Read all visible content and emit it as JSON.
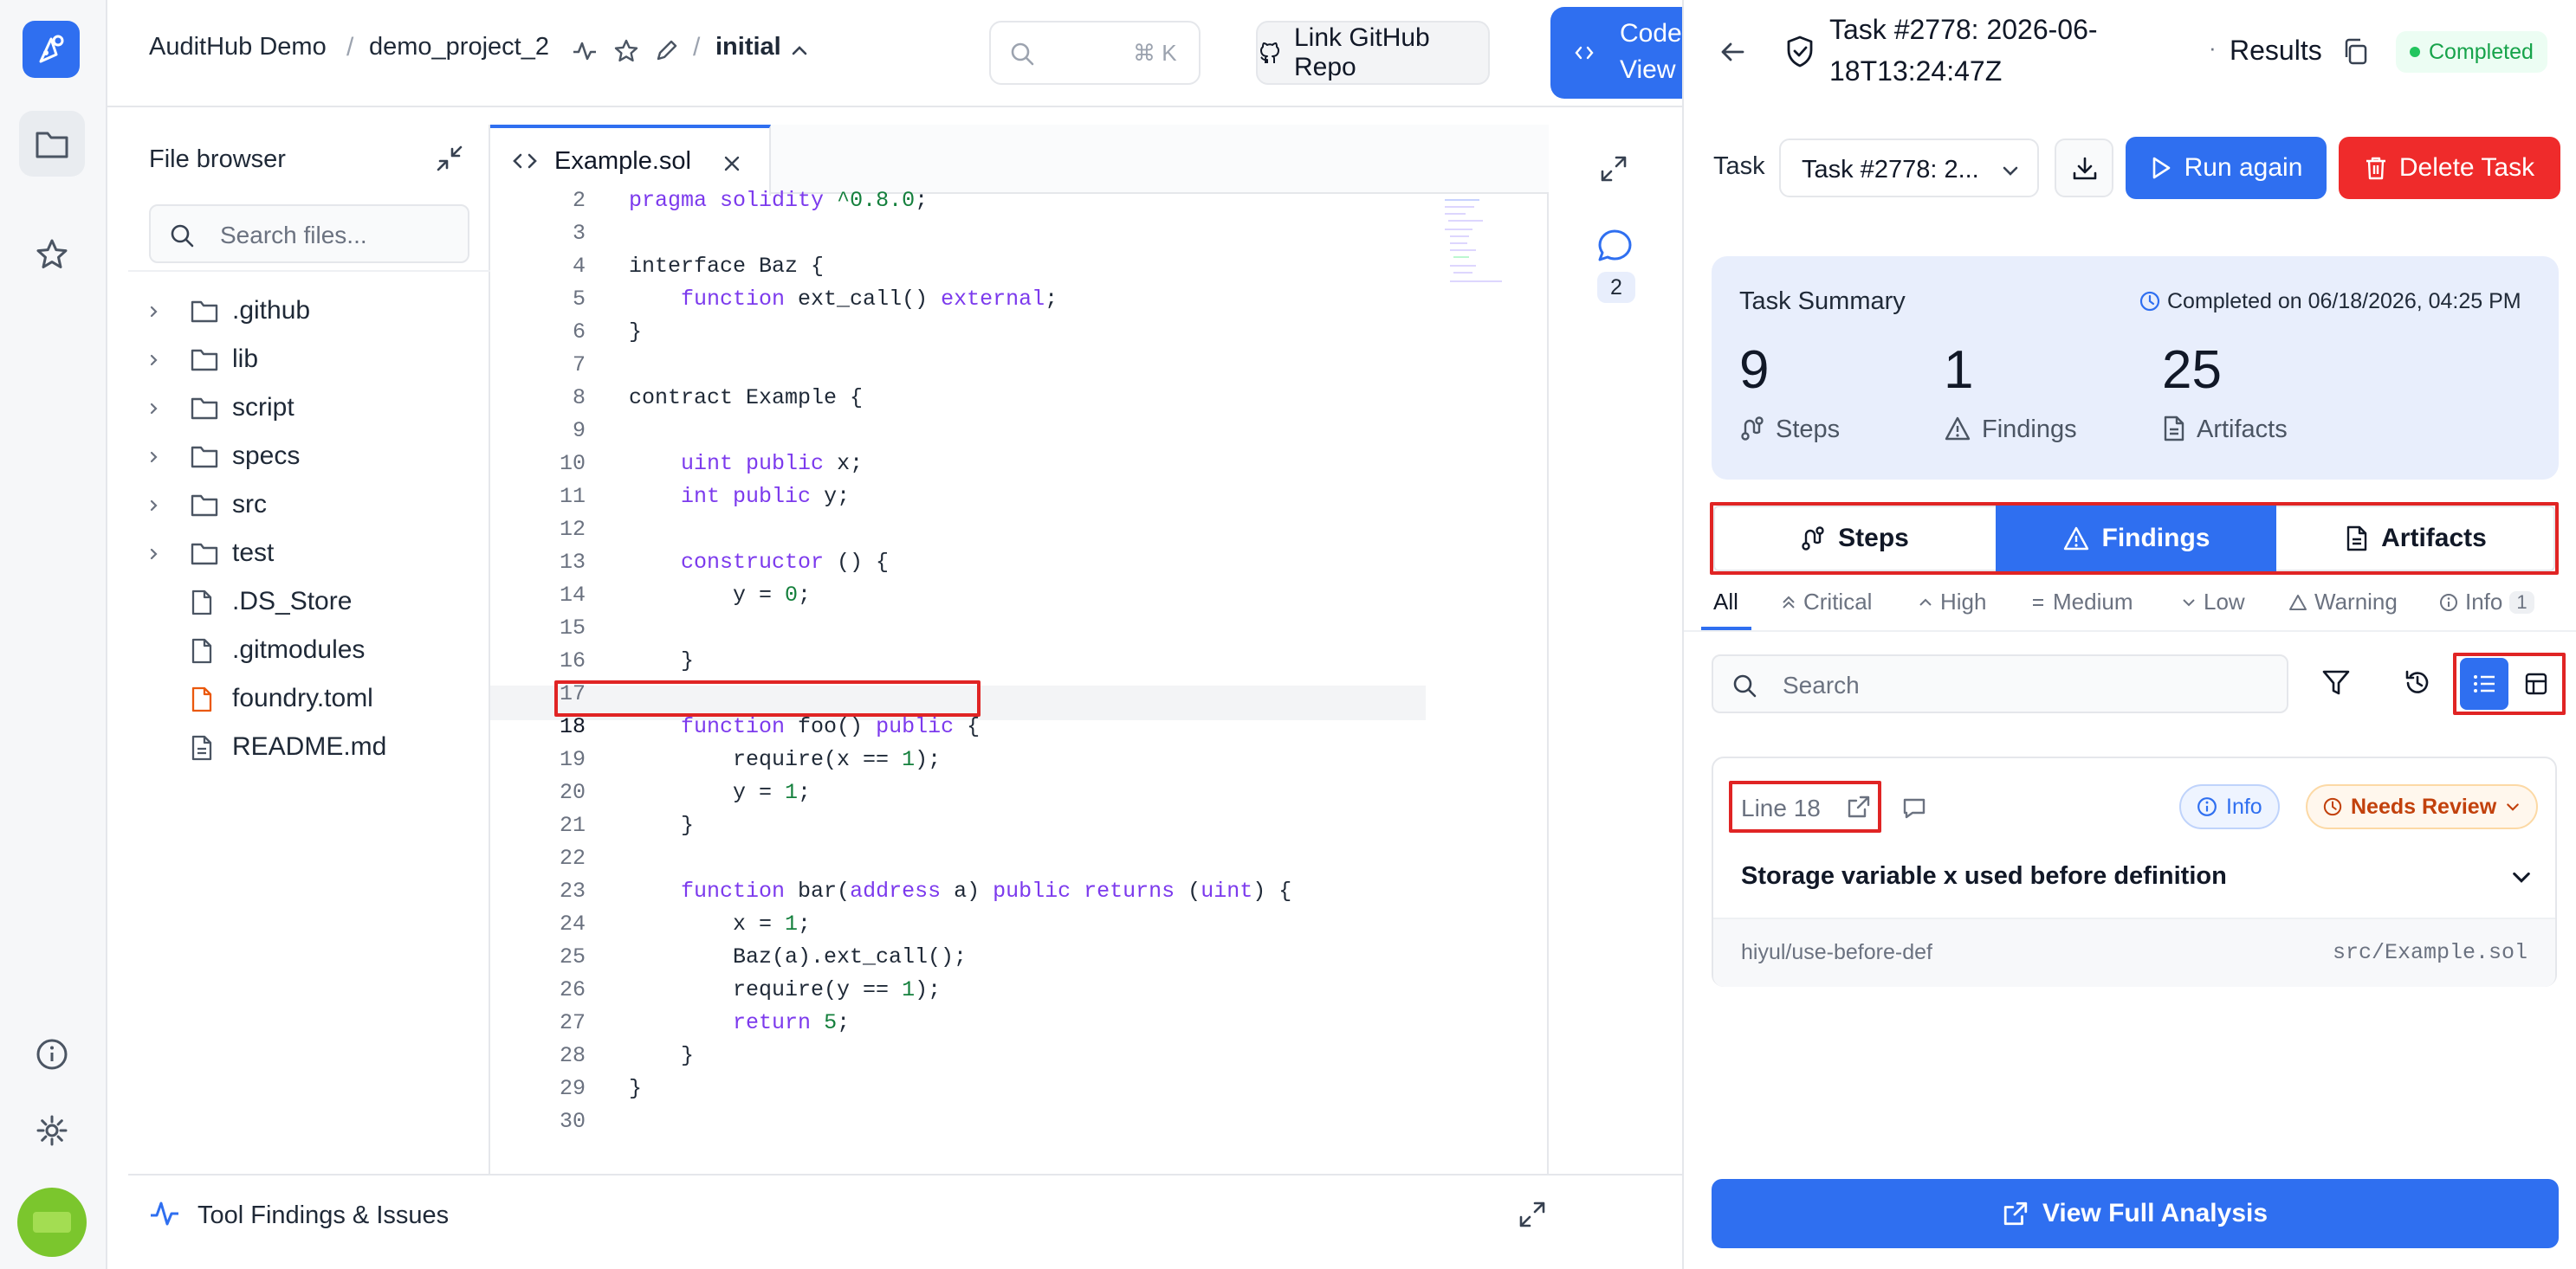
{
  "breadcrumb": {
    "org": "AuditHub Demo",
    "project": "demo_project_2",
    "version": "initial"
  },
  "search": {
    "shortcut": "⌘ K"
  },
  "header": {
    "link_github": "Link GitHub Repo",
    "code_view_line1": "Code",
    "code_view_line2": "View"
  },
  "file_browser": {
    "title": "File browser",
    "search_placeholder": "Search files...",
    "items": [
      {
        "name": ".github",
        "kind": "folder"
      },
      {
        "name": "lib",
        "kind": "folder"
      },
      {
        "name": "script",
        "kind": "folder"
      },
      {
        "name": "specs",
        "kind": "folder"
      },
      {
        "name": "src",
        "kind": "folder"
      },
      {
        "name": "test",
        "kind": "folder"
      },
      {
        "name": ".DS_Store",
        "kind": "file"
      },
      {
        "name": ".gitmodules",
        "kind": "file"
      },
      {
        "name": "foundry.toml",
        "kind": "toml"
      },
      {
        "name": "README.md",
        "kind": "doc"
      }
    ]
  },
  "editor": {
    "tab": "Example.sol",
    "highlight_line": 18,
    "line_numbers": [
      "2",
      "3",
      "4",
      "5",
      "6",
      "7",
      "8",
      "9",
      "10",
      "11",
      "12",
      "13",
      "14",
      "15",
      "16",
      "17",
      "18",
      "19",
      "20",
      "21",
      "22",
      "23",
      "24",
      "25",
      "26",
      "27",
      "28",
      "29",
      "30"
    ],
    "lines": [
      "pragma solidity ^0.8.0;",
      "",
      "interface Baz {",
      "    function ext_call() external;",
      "}",
      "",
      "contract Example {",
      "",
      "    uint public x;",
      "    int public y;",
      "",
      "    constructor () {",
      "        y = 0;",
      "",
      "    }",
      "",
      "    function foo() public {",
      "        require(x == 1);",
      "        y = 1;",
      "    }",
      "",
      "    function bar(address a) public returns (uint) {",
      "        x = 1;",
      "        Baz(a).ext_call();",
      "        require(y == 1);",
      "        return 5;",
      "    }",
      "}",
      ""
    ]
  },
  "comments": {
    "count": "2"
  },
  "bottom_panel": {
    "title": "Tool Findings & Issues"
  },
  "task": {
    "title_line1": "Task #2778: 2026-06-",
    "title_line2": "18T13:24:47Z",
    "results_label": "Results",
    "status": "Completed",
    "selector_label": "Task",
    "selector_value": "Task #2778: 2...",
    "run_again": "Run again",
    "delete": "Delete Task"
  },
  "summary": {
    "title": "Task Summary",
    "completed_on": "Completed on 06/18/2026, 04:25 PM",
    "steps_value": "9",
    "steps_label": "Steps",
    "findings_value": "1",
    "findings_label": "Findings",
    "artifacts_value": "25",
    "artifacts_label": "Artifacts"
  },
  "view_tabs": {
    "steps": "Steps",
    "findings": "Findings",
    "artifacts": "Artifacts",
    "active": "Findings"
  },
  "severity_filters": {
    "all": "All",
    "critical": "Critical",
    "high": "High",
    "medium": "Medium",
    "low": "Low",
    "warning": "Warning",
    "info": "Info",
    "info_count": "1"
  },
  "findings_search": {
    "placeholder": "Search"
  },
  "finding": {
    "line": "Line 18",
    "severity": "Info",
    "review_status": "Needs Review",
    "title": "Storage variable x used before definition",
    "rule": "hiyul/use-before-def",
    "file": "src/Example.sol"
  },
  "view_full": "View Full Analysis",
  "colors": {
    "accent": "#2f6ff0",
    "danger": "#ef2b2b",
    "success": "#16a34a",
    "warning": "#c2410c",
    "annotation": "#e02424"
  }
}
